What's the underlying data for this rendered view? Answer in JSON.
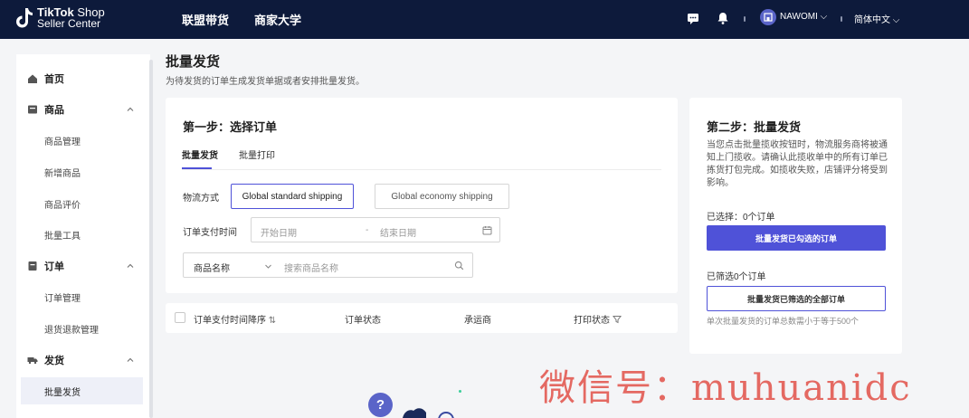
{
  "header": {
    "logo_brand": "TikTok",
    "logo_brand2": "Shop",
    "logo_sub": "Seller Center",
    "nav": [
      "联盟带货",
      "商家大学"
    ],
    "user_name": "NAWOMI",
    "language": "简体中文"
  },
  "sidebar": {
    "items": [
      {
        "label": "首页",
        "icon": "home-icon"
      },
      {
        "label": "商品",
        "icon": "product-icon"
      },
      {
        "label": "商品管理"
      },
      {
        "label": "新增商品"
      },
      {
        "label": "商品评价"
      },
      {
        "label": "批量工具"
      },
      {
        "label": "订单",
        "icon": "order-icon"
      },
      {
        "label": "订单管理"
      },
      {
        "label": "退货退款管理"
      },
      {
        "label": "发货",
        "icon": "truck-icon"
      },
      {
        "label": "批量发货"
      }
    ]
  },
  "page": {
    "title": "批量发货",
    "subtitle": "为待发货的订单生成发货单据或者安排批量发货。"
  },
  "step1": {
    "title": "第一步：选择订单",
    "tabs": [
      "批量发货",
      "批量打印"
    ],
    "shipping_label": "物流方式",
    "shipping_options": [
      "Global standard shipping",
      "Global economy shipping"
    ],
    "pay_time_label": "订单支付时间",
    "start_placeholder": "开始日期",
    "date_sep": "-",
    "end_placeholder": "结束日期",
    "search_select": "商品名称",
    "search_placeholder": "搜索商品名称"
  },
  "table": {
    "columns": [
      "订单支付时间降序",
      "订单状态",
      "承运商",
      "打印状态"
    ]
  },
  "step2": {
    "title": "第二步：批量发货",
    "desc": "当您点击批量揽收按钮时，物流服务商将被通知上门揽收。请确认此揽收单中的所有订单已拣货打包完成。如揽收失败，店铺评分将受到影响。",
    "selected": "已选择：0个订单",
    "primary_btn": "批量发货已勾选的订单",
    "filtered": "已筛选0个订单",
    "outline_btn": "批量发货已筛选的全部订单",
    "note": "单次批量发货的订单总数需小于等于500个"
  },
  "watermark": "微信号：muhuanidc",
  "colors": {
    "accent": "#4f52d8",
    "topbar": "#0d1a3b"
  }
}
